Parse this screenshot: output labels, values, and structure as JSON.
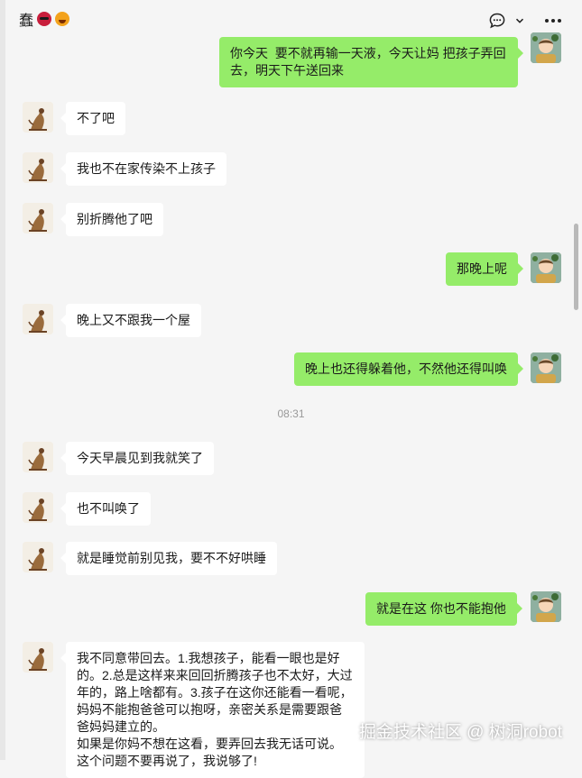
{
  "header": {
    "title": "蠢",
    "emojis": [
      "angry-face",
      "hot-face"
    ],
    "icons": [
      "chat-bubble-icon",
      "chevron-down-icon",
      "more-icon"
    ]
  },
  "colors": {
    "background": "#f5f5f5",
    "incoming_bubble": "#ffffff",
    "outgoing_bubble": "#95ec69"
  },
  "messages": [
    {
      "from": "me",
      "text": "你今天  要不就再输一天液，今天让妈 把孩子弄回去，明天下午送回来"
    },
    {
      "from": "other",
      "text": "不了吧"
    },
    {
      "from": "other",
      "text": "我也不在家传染不上孩子"
    },
    {
      "from": "other",
      "text": "别折腾他了吧"
    },
    {
      "from": "me",
      "text": "那晚上呢"
    },
    {
      "from": "other",
      "text": "晚上又不跟我一个屋"
    },
    {
      "from": "me",
      "text": "晚上也还得躲着他，不然他还得叫唤"
    },
    {
      "from": "time",
      "text": "08:31"
    },
    {
      "from": "other",
      "text": "今天早晨见到我就笑了"
    },
    {
      "from": "other",
      "text": "也不叫唤了"
    },
    {
      "from": "other",
      "text": "就是睡觉前别见我，要不不好哄睡"
    },
    {
      "from": "me",
      "text": "就是在这 你也不能抱他"
    },
    {
      "from": "other",
      "text": "我不同意带回去。1.我想孩子，能看一眼也是好的。2.总是这样来来回回折腾孩子也不太好，大过年的，路上啥都有。3.孩子在这你还能看一看呢，妈妈不能抱爸爸可以抱呀，亲密关系是需要跟爸爸妈妈建立的。\n如果是你妈不想在这看，要弄回去我无话可说。\n这个问题不要再说了，我说够了!"
    }
  ],
  "watermark": "掘金技术社区 @ 树洞robot"
}
